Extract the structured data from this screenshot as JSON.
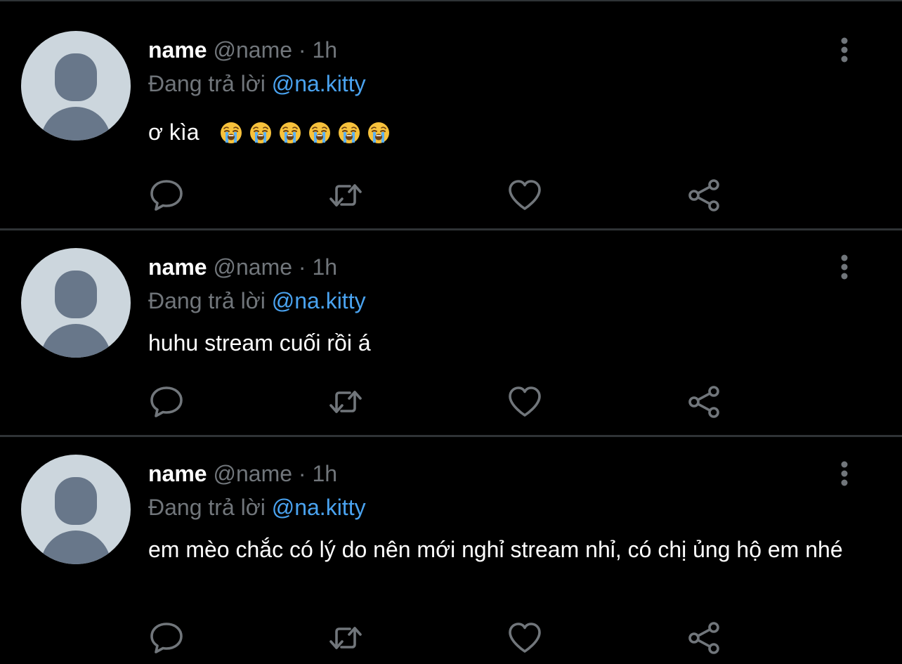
{
  "colors": {
    "background": "#000000",
    "divider": "#2f3336",
    "muted": "#71767b",
    "mention": "#4aa3f0",
    "avatar_bg": "#ccd6dd",
    "avatar_fg": "#68778a"
  },
  "icons": {
    "reply": "speech-bubble-icon",
    "retweet": "retweet-icon",
    "like": "heart-icon",
    "share": "share-icon",
    "more": "vertical-dots-icon"
  },
  "tweets": [
    {
      "display_name": "name",
      "handle": "@name",
      "separator": "·",
      "time": "1h",
      "reply_prefix": "Đang trả lời",
      "reply_to": "@na.kitty",
      "text": "ơ kìa",
      "emoji": [
        "loudly-crying-face",
        "loudly-crying-face",
        "loudly-crying-face",
        "loudly-crying-face",
        "loudly-crying-face",
        "loudly-crying-face"
      ]
    },
    {
      "display_name": "name",
      "handle": "@name",
      "separator": "·",
      "time": "1h",
      "reply_prefix": "Đang trả lời",
      "reply_to": "@na.kitty",
      "text": "huhu stream cuối rồi á",
      "emoji": []
    },
    {
      "display_name": "name",
      "handle": "@name",
      "separator": "·",
      "time": "1h",
      "reply_prefix": "Đang trả lời",
      "reply_to": "@na.kitty",
      "text": "em mèo chắc có lý do nên mới nghỉ stream nhỉ, có chị ủng hộ em nhé",
      "emoji": []
    }
  ]
}
